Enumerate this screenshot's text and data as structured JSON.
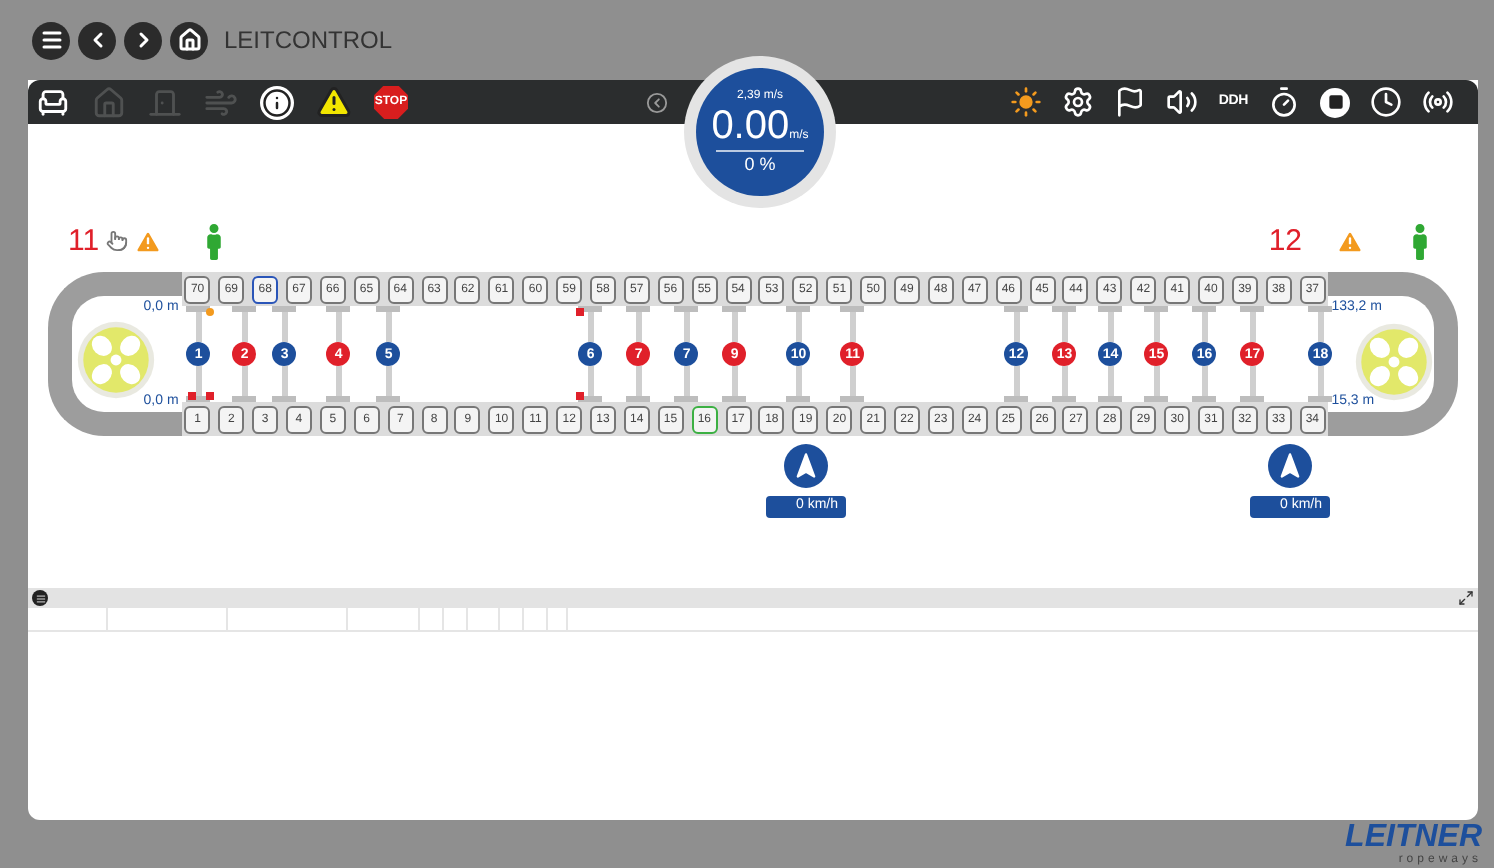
{
  "window": {
    "title": "LEITCONTROL"
  },
  "nav_buttons": [
    {
      "kind": "menu"
    },
    {
      "kind": "back"
    },
    {
      "kind": "forward"
    },
    {
      "kind": "home"
    }
  ],
  "toolbar": {
    "left": [
      {
        "kind": "seat",
        "disabled": false
      },
      {
        "kind": "home",
        "disabled": true
      },
      {
        "kind": "door",
        "disabled": true
      },
      {
        "kind": "wind",
        "disabled": true
      },
      {
        "kind": "info",
        "disabled": false
      },
      {
        "kind": "warning",
        "disabled": false
      },
      {
        "kind": "stop",
        "label": "STOP",
        "disabled": false
      },
      {
        "kind": "collapse",
        "disabled": false
      }
    ],
    "right": [
      {
        "kind": "burst"
      },
      {
        "kind": "gear"
      },
      {
        "kind": "windsock"
      },
      {
        "kind": "speaker"
      },
      {
        "kind": "text",
        "label": "DDH"
      },
      {
        "kind": "stopwatch"
      },
      {
        "kind": "stop-circle"
      },
      {
        "kind": "clock-list"
      },
      {
        "kind": "radio"
      }
    ]
  },
  "speed_gauge": {
    "max": "2,39 m/s",
    "value": "0.00",
    "unit": "m/s",
    "percent": "0 %"
  },
  "stations": [
    {
      "number": "11",
      "warning": true,
      "operator": true
    },
    {
      "number": "12",
      "warning": true,
      "operator": true
    }
  ],
  "track": {
    "distances": {
      "top_left": "0,0 m",
      "bottom_left": "0,0 m",
      "top_right": "133,2 m",
      "bottom_right": "15,3 m"
    },
    "top_carriers": [
      {
        "label": "70"
      },
      {
        "label": "69"
      },
      {
        "label": "68",
        "color": "#2a55b8"
      },
      {
        "label": "67"
      },
      {
        "label": "66"
      },
      {
        "label": "65"
      },
      {
        "label": "64"
      },
      {
        "label": "63"
      },
      {
        "label": "62"
      },
      {
        "label": "61"
      },
      {
        "label": "60"
      },
      {
        "label": "59"
      },
      {
        "label": "58"
      },
      {
        "label": "57"
      },
      {
        "label": "56"
      },
      {
        "label": "55"
      },
      {
        "label": "54"
      },
      {
        "label": "53"
      },
      {
        "label": "52"
      },
      {
        "label": "51"
      },
      {
        "label": "50"
      },
      {
        "label": "49"
      },
      {
        "label": "48"
      },
      {
        "label": "47"
      },
      {
        "label": "46"
      },
      {
        "label": "45"
      },
      {
        "label": "44"
      },
      {
        "label": "43"
      },
      {
        "label": "42"
      },
      {
        "label": "41"
      },
      {
        "label": "40"
      },
      {
        "label": "39"
      },
      {
        "label": "38"
      },
      {
        "label": "37"
      }
    ],
    "bottom_carriers": [
      {
        "label": "1"
      },
      {
        "label": "2"
      },
      {
        "label": "3"
      },
      {
        "label": "4"
      },
      {
        "label": "5"
      },
      {
        "label": "6"
      },
      {
        "label": "7"
      },
      {
        "label": "8"
      },
      {
        "label": "9"
      },
      {
        "label": "10"
      },
      {
        "label": "11"
      },
      {
        "label": "12"
      },
      {
        "label": "13"
      },
      {
        "label": "14"
      },
      {
        "label": "15"
      },
      {
        "label": "16",
        "color": "#3cb043"
      },
      {
        "label": "17"
      },
      {
        "label": "18"
      },
      {
        "label": "19"
      },
      {
        "label": "20"
      },
      {
        "label": "21"
      },
      {
        "label": "22"
      },
      {
        "label": "23"
      },
      {
        "label": "24"
      },
      {
        "label": "25"
      },
      {
        "label": "26"
      },
      {
        "label": "27"
      },
      {
        "label": "28"
      },
      {
        "label": "29"
      },
      {
        "label": "30"
      },
      {
        "label": "31"
      },
      {
        "label": "32"
      },
      {
        "label": "33"
      },
      {
        "label": "34"
      }
    ],
    "vehicles": [
      {
        "label": "1",
        "color": "#1d4f9c"
      },
      {
        "label": "2",
        "color": "#e0202a"
      },
      {
        "label": "3",
        "color": "#1d4f9c"
      },
      {
        "label": "4",
        "color": "#e0202a"
      },
      {
        "label": "5",
        "color": "#1d4f9c"
      },
      {
        "label": "6",
        "color": "#1d4f9c"
      },
      {
        "label": "7",
        "color": "#e0202a"
      },
      {
        "label": "7",
        "color": "#1d4f9c"
      },
      {
        "label": "9",
        "color": "#e0202a"
      },
      {
        "label": "10",
        "color": "#1d4f9c"
      },
      {
        "label": "11",
        "color": "#e0202a"
      },
      {
        "label": "12",
        "color": "#1d4f9c"
      },
      {
        "label": "13",
        "color": "#e0202a"
      },
      {
        "label": "14",
        "color": "#1d4f9c"
      },
      {
        "label": "15",
        "color": "#e0202a"
      },
      {
        "label": "16",
        "color": "#1d4f9c"
      },
      {
        "label": "17",
        "color": "#e0202a"
      },
      {
        "label": "18",
        "color": "#1d4f9c"
      }
    ]
  },
  "wind_sensors": [
    {
      "speed": "0 km/h"
    },
    {
      "speed": "0 km/h"
    }
  ],
  "logo": {
    "name": "LEITNER",
    "tagline": "ropeways"
  }
}
